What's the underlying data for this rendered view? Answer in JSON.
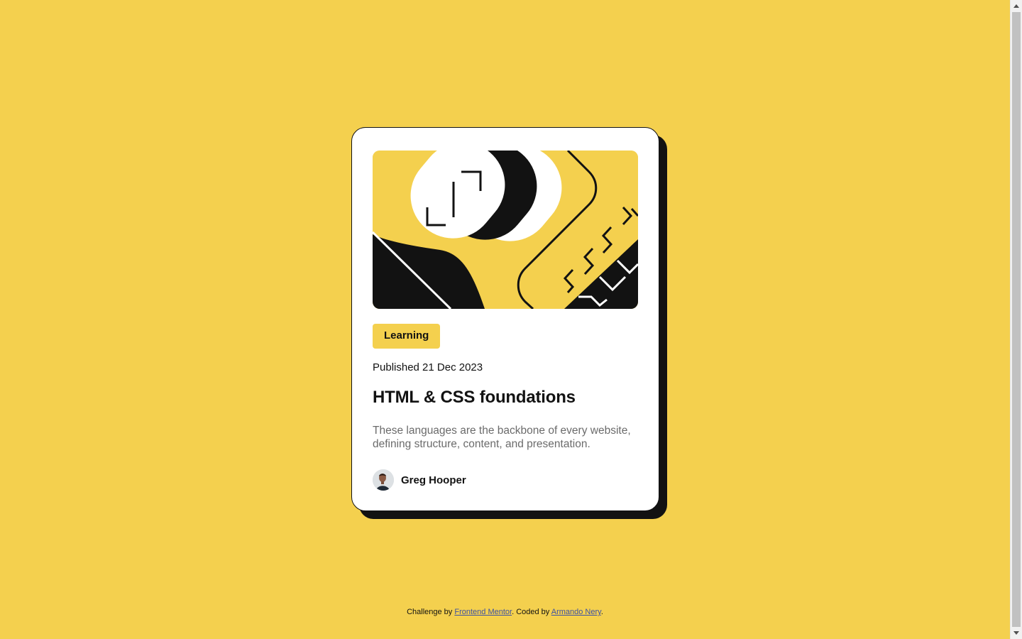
{
  "card": {
    "tag": "Learning",
    "published": "Published 21 Dec 2023",
    "title": "HTML & CSS foundations",
    "description": "These languages are the backbone of every website, defining structure, content, and presentation.",
    "author": "Greg Hooper",
    "image_icon": "illustration-article",
    "avatar_icon": "avatar-greg-hooper"
  },
  "footer": {
    "challenge_prefix": "Challenge by ",
    "challenge_link": "Frontend Mentor",
    "coded_prefix": ". Coded by ",
    "coded_link": "Armando Nery",
    "suffix": "."
  },
  "colors": {
    "background": "#f4d04e",
    "text": "#121212",
    "muted": "#6b6b6b",
    "card": "#ffffff",
    "link": "#3e52a3"
  }
}
